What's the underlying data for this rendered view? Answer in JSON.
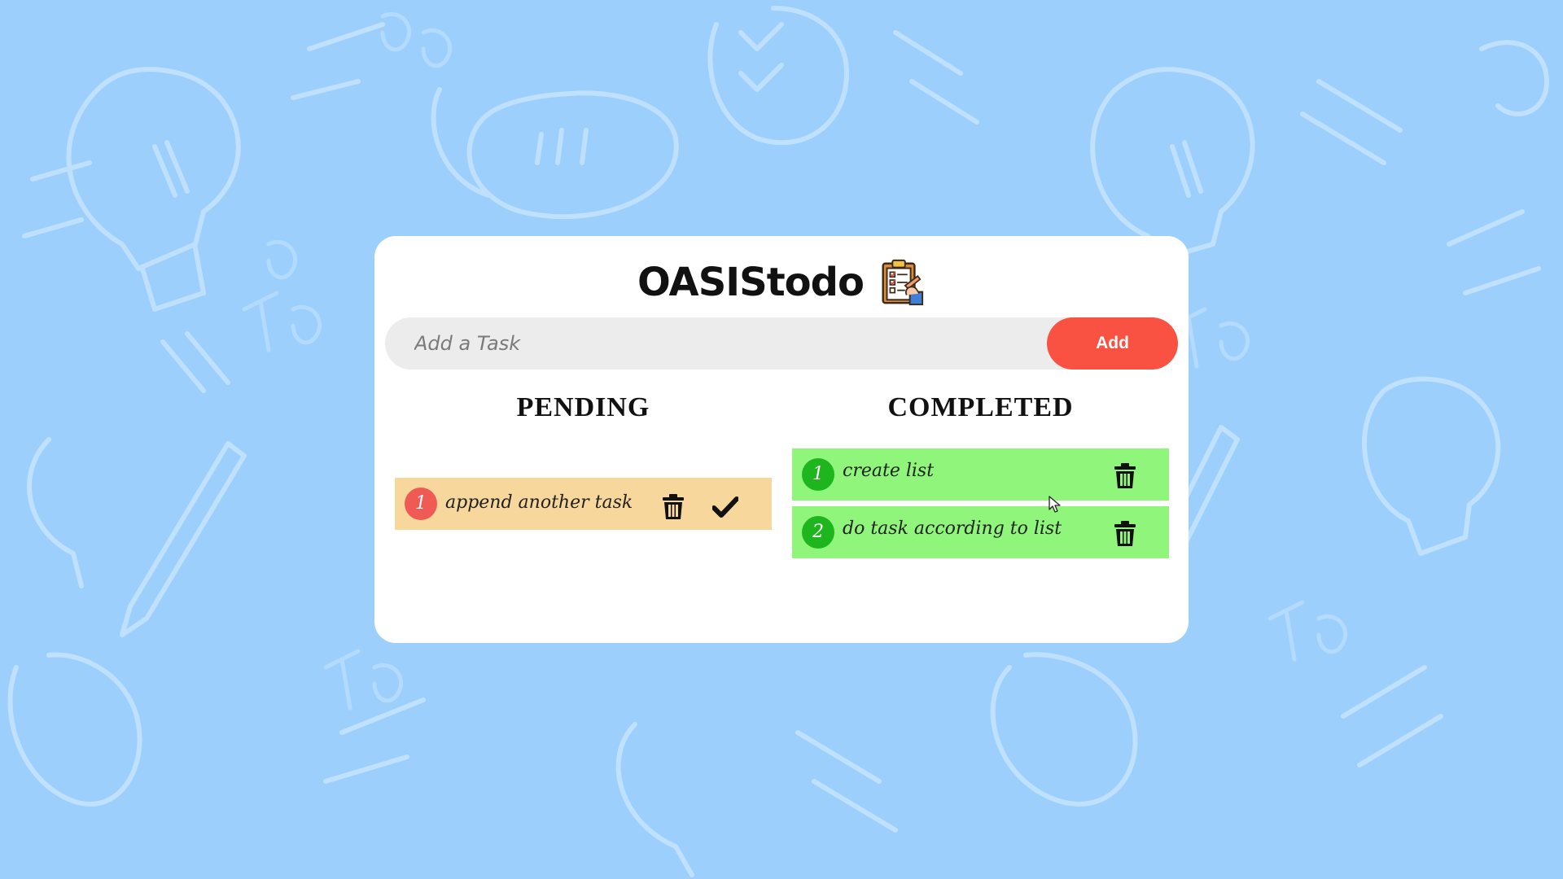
{
  "app": {
    "title": "OASIStodo",
    "logo_icon": "clipboard-checklist-icon"
  },
  "input": {
    "placeholder": "Add a Task",
    "value": "",
    "add_label": "Add"
  },
  "columns": {
    "pending_title": "PENDING",
    "completed_title": "COMPLETED"
  },
  "pending": [
    {
      "number": "1",
      "text": "append another task"
    }
  ],
  "completed": [
    {
      "number": "1",
      "text": "create list"
    },
    {
      "number": "2",
      "text": "do task according to list"
    }
  ],
  "colors": {
    "background": "#9ccffb",
    "card": "#ffffff",
    "add_button": "#fa5242",
    "pending_item": "#f7d79c",
    "pending_badge": "#f05a55",
    "completed_item": "#90f57b",
    "completed_badge": "#1eb51e"
  }
}
